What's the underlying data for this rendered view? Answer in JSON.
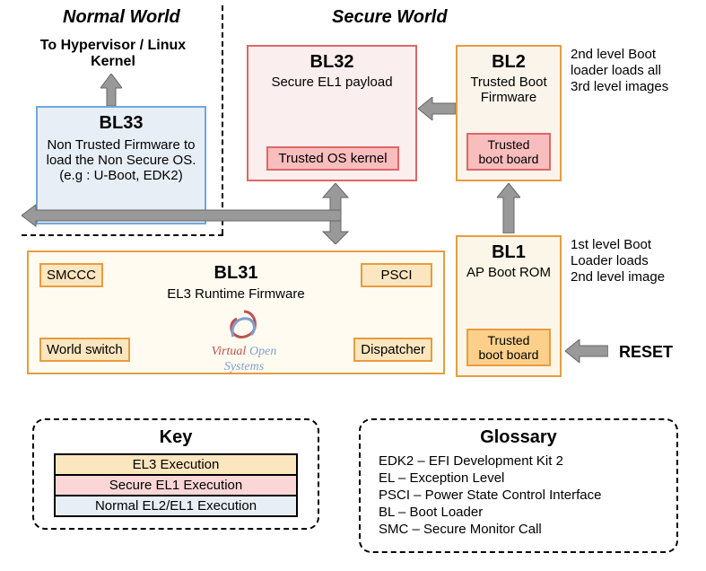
{
  "labels": {
    "normal_world": "Normal World",
    "secure_world": "Secure World",
    "to_hypervisor": "To Hypervisor / Linux Kernel",
    "reset": "RESET"
  },
  "bl33": {
    "title": "BL33",
    "desc": "Non Trusted Firmware to load the Non Secure OS. (e.g : U-Boot, EDK2)"
  },
  "bl32": {
    "title": "BL32",
    "desc": "Secure EL1 payload",
    "inner": "Trusted OS kernel"
  },
  "bl2": {
    "title": "BL2",
    "desc": "Trusted Boot Firmware",
    "inner": "Trusted boot board",
    "note": "2nd level Boot loader loads all 3rd level images"
  },
  "bl1": {
    "title": "BL1",
    "desc": "AP Boot ROM",
    "inner": "Trusted boot board",
    "note": "1st level Boot Loader loads 2nd level image"
  },
  "bl31": {
    "title": "BL31",
    "desc": "EL3 Runtime Firmware",
    "smccc": "SMCCC",
    "psci": "PSCI",
    "world_switch": "World switch",
    "dispatcher": "Dispatcher",
    "logo_a": "Virtual",
    "logo_b": "Open Systems"
  },
  "key": {
    "title": "Key",
    "el3": "EL3 Execution",
    "sel1": "Secure EL1 Execution",
    "nel": "Normal EL2/EL1 Execution"
  },
  "glossary": {
    "title": "Glossary",
    "lines": [
      "EDK2 – EFI Development Kit 2",
      "EL – Exception Level",
      "PSCI – Power State Control Interface",
      "BL – Boot Loader",
      "SMC – Secure Monitor Call"
    ]
  }
}
